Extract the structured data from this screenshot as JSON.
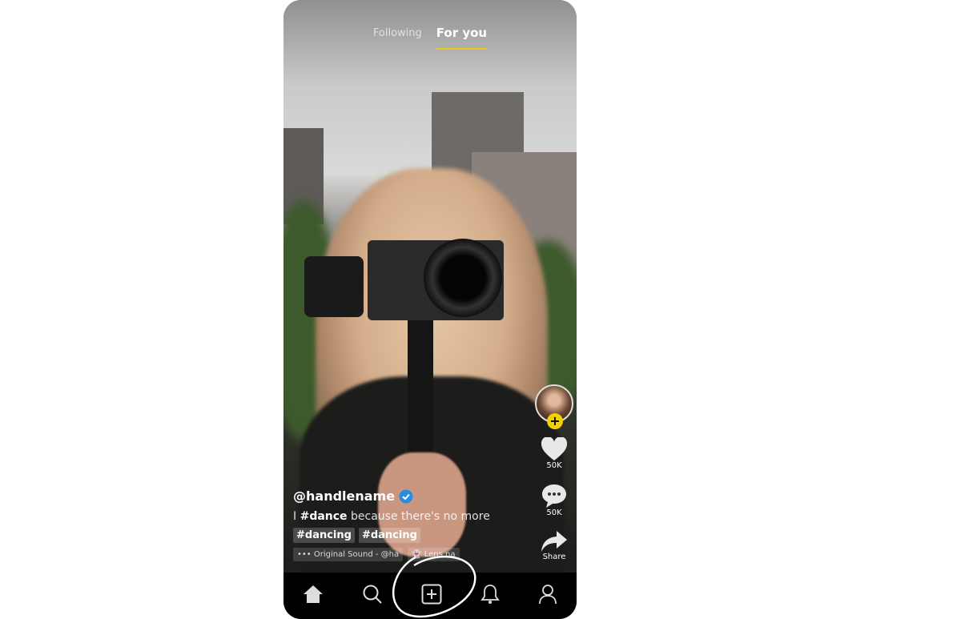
{
  "header": {
    "tabs": [
      {
        "label": "Following",
        "active": false
      },
      {
        "label": "For you",
        "active": true
      }
    ],
    "accent": "#f5c518"
  },
  "post": {
    "handle": "@handlename",
    "verified": true,
    "description_hashtag": "#dance",
    "description_rest": " because there's no more",
    "description_prefix": "I ",
    "tags": [
      "#dancing",
      "#dancing"
    ],
    "sound": "Original Sound - @ha",
    "lens": "Lens na"
  },
  "actions": {
    "likes": "50K",
    "comments": "50K",
    "share": "Share"
  },
  "nav": {
    "items": [
      "home-icon",
      "search-icon",
      "create-icon",
      "bell-icon",
      "profile-icon"
    ]
  }
}
